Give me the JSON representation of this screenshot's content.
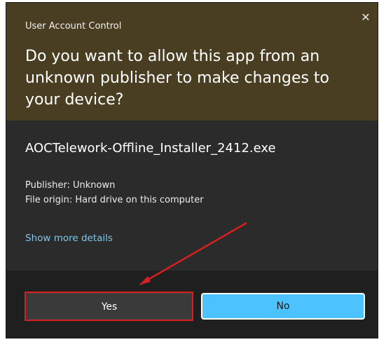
{
  "dialog": {
    "title": "User Account Control",
    "close_icon": "close-icon",
    "question": "Do you want to allow this app from an unknown publisher to make changes to your device?",
    "app_name": "AOCTelework-Offline_Installer_2412.exe",
    "publisher": "Publisher: Unknown",
    "file_origin": "File origin: Hard drive on this computer",
    "details_link": "Show more details",
    "yes_label": "Yes",
    "no_label": "No"
  },
  "colors": {
    "header_bg": "#4a3e22",
    "body_bg": "#2b2b2b",
    "footer_bg": "#1f1f1f",
    "accent": "#4cc2ff",
    "link": "#7fc8e8",
    "annotation": "#d62020"
  }
}
